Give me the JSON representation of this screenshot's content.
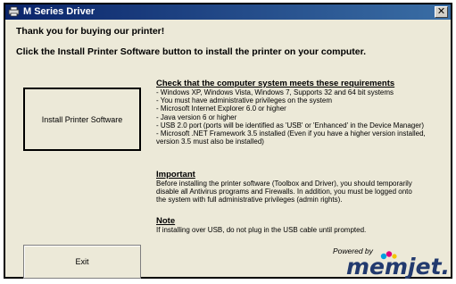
{
  "window": {
    "title": "M Series Driver",
    "close_glyph": "✕"
  },
  "intro": {
    "thanks": "Thank you for buying our printer!",
    "instruction": "Click the Install Printer Software button to install the printer on your computer."
  },
  "buttons": {
    "install": "Install Printer Software",
    "exit": "Exit"
  },
  "requirements": {
    "title": "Check that the computer system meets these requirements",
    "lines": [
      "- Windows XP, Windows Vista, Windows 7, Supports 32 and 64 bit systems",
      "- You must have administrative  privileges on the system",
      "- Microsoft Internet Explorer 6.0 or higher",
      "- Java version 6 or higher",
      "- USB 2.0 port (ports will be identified as 'USB' or 'Enhanced' in the Device Manager)",
      "- Microsoft .NET Framework 3.5 installed (Even if you have a higher version installed,",
      "version 3.5 must also be installed)"
    ]
  },
  "important": {
    "title": "Important",
    "lines": [
      "Before installing the printer software (Toolbox and Driver), you should temporarily",
      "disable all Antivirus programs and Firewalls. In addition, you must be logged onto",
      "the system with full administrative privileges (admin rights)."
    ]
  },
  "note": {
    "title": "Note",
    "lines": [
      "If installing over USB, do not plug in the USB cable until prompted."
    ]
  },
  "logo": {
    "powered_by": "Powered by",
    "brand": "memjet.",
    "dot_colors": [
      "#00a0e0",
      "#e0007a",
      "#f5c400"
    ]
  }
}
